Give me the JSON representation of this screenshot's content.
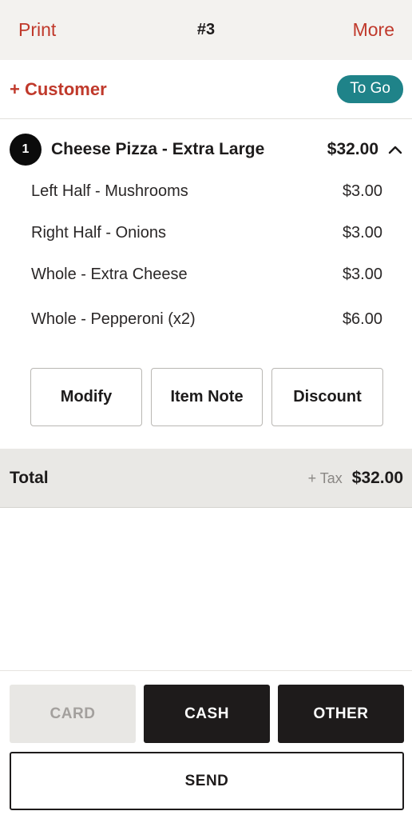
{
  "header": {
    "print_label": "Print",
    "order_number": "#3",
    "more_label": "More"
  },
  "customer": {
    "add_label": "+ Customer",
    "order_type": "To Go"
  },
  "item": {
    "quantity": "1",
    "name": "Cheese Pizza - Extra Large",
    "price": "$32.00",
    "expand_icon": "chevron-up-icon",
    "modifiers": [
      {
        "label": "Left Half - Mushrooms",
        "price": "$3.00"
      },
      {
        "label": "Right Half - Onions",
        "price": "$3.00"
      },
      {
        "label": "Whole - Extra Cheese",
        "price": "$3.00"
      },
      {
        "label": "Whole - Pepperoni (x2)",
        "price": "$6.00"
      }
    ],
    "actions": {
      "modify": "Modify",
      "item_note": "Item Note",
      "discount": "Discount"
    }
  },
  "total": {
    "label": "Total",
    "tax_label": "+ Tax",
    "amount": "$32.00"
  },
  "payment": {
    "card": "CARD",
    "cash": "CASH",
    "other": "OTHER",
    "send": "SEND"
  },
  "colors": {
    "accent_red": "#c0392b",
    "teal": "#1f8389",
    "dark": "#1e1b1b"
  }
}
